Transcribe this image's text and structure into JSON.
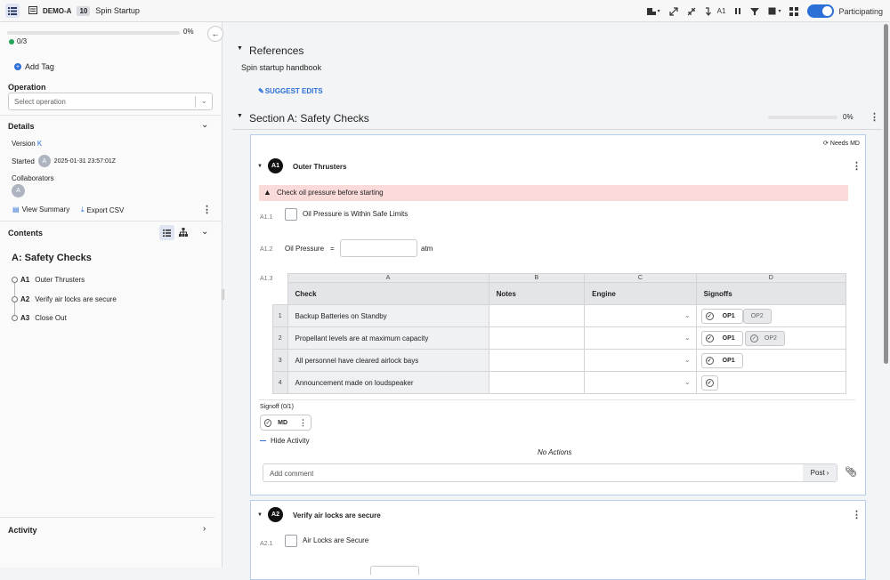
{
  "topbar": {
    "doc_id": "DEMO-A",
    "doc_rev": "10",
    "doc_title": "Spin Startup",
    "step_label": "A1",
    "participating_label": "Participating"
  },
  "sidebar": {
    "progress_pct": "0%",
    "progress_fraction": 0,
    "completed": "0/3",
    "add_tag": "Add Tag",
    "operation_label": "Operation",
    "operation_placeholder": "Select operation",
    "details_label": "Details",
    "version_label": "Version",
    "version_value": "K",
    "started_label": "Started",
    "started_avatar": "A",
    "started_value": "2025-01-31 23:57:01Z",
    "collaborators_label": "Collaborators",
    "collab_avatar": "A",
    "view_summary": "View Summary",
    "export_csv": "Export CSV",
    "contents_label": "Contents",
    "section_title": "A: Safety Checks",
    "items": [
      {
        "id": "A1",
        "label": "Outer Thrusters"
      },
      {
        "id": "A2",
        "label": "Verify air locks are secure"
      },
      {
        "id": "A3",
        "label": "Close Out"
      }
    ],
    "activity_label": "Activity"
  },
  "main": {
    "references_title": "References",
    "references_item": "Spin startup handbook",
    "suggest_edits": "SUGGEST EDITS",
    "section_title": "Section A: Safety Checks",
    "section_pct": "0%",
    "section_fraction": 0,
    "needs": "Needs MD",
    "step1": {
      "badge": "A1",
      "title": "Outer Thrusters",
      "warning": "Check oil pressure before starting",
      "a11_num": "A1.1",
      "a11_label": "Oil Pressure is Within Safe Limits",
      "a12_num": "A1.2",
      "a12_label": "Oil Pressure",
      "a12_eq": "=",
      "a12_unit": "atm",
      "a13_num": "A1.3",
      "table": {
        "letters": [
          "A",
          "B",
          "C",
          "D"
        ],
        "headers": [
          "Check",
          "Notes",
          "Engine",
          "Signoffs"
        ],
        "rows": [
          {
            "n": "1",
            "check": "Backup Batteries on Standby",
            "signoffs": [
              "OP1",
              "OP2"
            ]
          },
          {
            "n": "2",
            "check": "Propellant levels are at maximum capacity",
            "signoffs": [
              "OP1",
              "OP2"
            ]
          },
          {
            "n": "3",
            "check": "All personnel have cleared airlock bays",
            "signoffs": [
              "OP1"
            ]
          },
          {
            "n": "4",
            "check": "Announcement made on loudspeaker",
            "signoffs": []
          }
        ]
      },
      "signoff_label": "Signoff (0/1)",
      "signoff_role": "MD",
      "hide_activity": "Hide Activity",
      "no_actions": "No Actions",
      "comment_placeholder": "Add comment",
      "post": "Post"
    },
    "step2": {
      "badge": "A2",
      "title": "Verify air locks are secure",
      "a21_num": "A2.1",
      "a21_label": "Air Locks are Secure"
    }
  },
  "colors": {
    "accent": "#2c6fd6",
    "warning_bg": "#fbdada",
    "success": "#23a55a"
  }
}
